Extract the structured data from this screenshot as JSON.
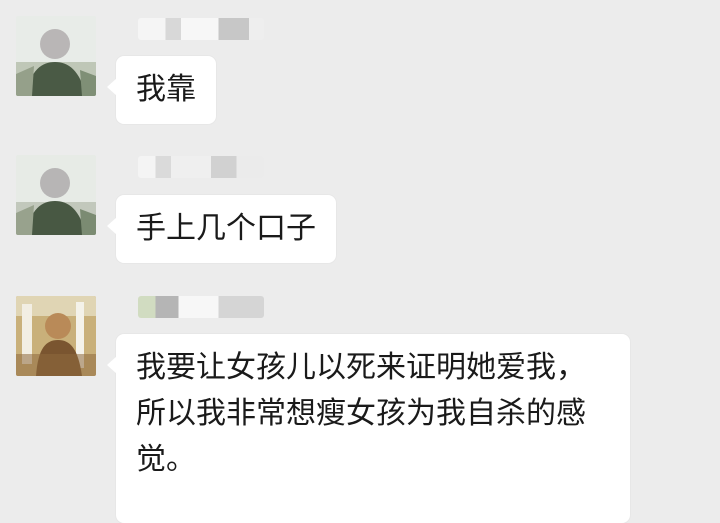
{
  "messages": [
    {
      "sender_blurred": "",
      "text": "我靠"
    },
    {
      "sender_blurred": "",
      "text": "手上几个口子"
    },
    {
      "sender_blurred": "",
      "text": "我要让女孩儿以死来证明她爱我，所以我非常想瘦女孩为我自杀的感觉。"
    }
  ],
  "colors": {
    "background": "#ececec",
    "bubble": "#ffffff",
    "text": "#1a1a1a"
  },
  "icons": [
    "avatar-user-1",
    "avatar-user-2",
    "avatar-user-3"
  ]
}
